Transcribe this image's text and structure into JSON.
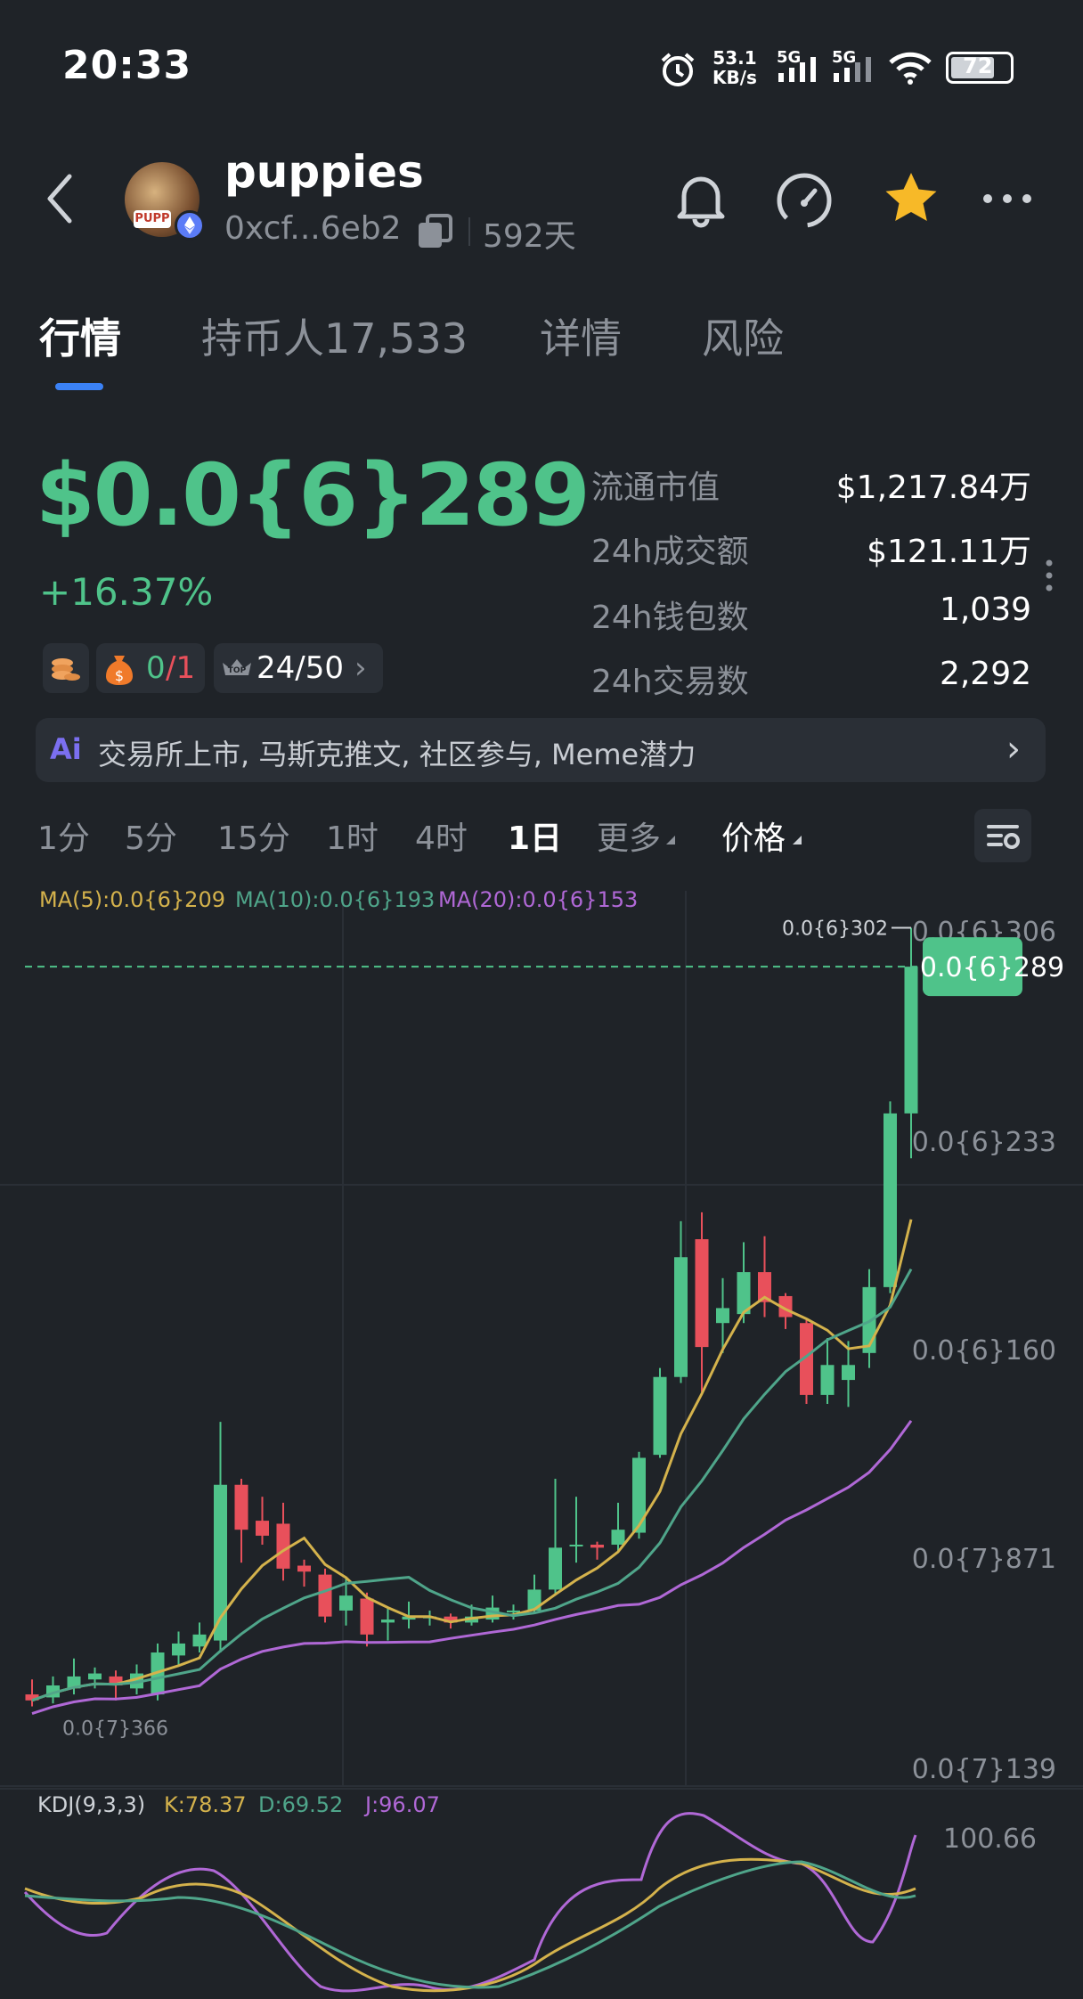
{
  "status_bar": {
    "time": "20:33",
    "net_speed_value": "53.1",
    "net_speed_unit": "KB/s",
    "sim1": "5G",
    "sim2": "5G",
    "battery": "72"
  },
  "token": {
    "name": "puppies",
    "address": "0xcf...6eb2",
    "age": "592天",
    "avatar_tag": "PUPP"
  },
  "tabs": [
    {
      "label": "行情"
    },
    {
      "label": "持币人17,533"
    },
    {
      "label": "详情"
    },
    {
      "label": "风险"
    }
  ],
  "price": {
    "value": "$0.0{6}289",
    "change": "+16.37%",
    "badge_fraction_ok": "0",
    "badge_fraction_total": "/1",
    "rank": "24/50"
  },
  "stats": [
    {
      "label": "流通市值",
      "value": "$1,217.84万"
    },
    {
      "label": "24h成交额",
      "value": "$121.11万"
    },
    {
      "label": "24h钱包数",
      "value": "1,039"
    },
    {
      "label": "24h交易数",
      "value": "2,292"
    }
  ],
  "ai_banner": {
    "icon": "Ai",
    "text": "交易所上市, 马斯克推文, 社区参与, Meme潜力"
  },
  "intervals": [
    {
      "label": "1分"
    },
    {
      "label": "5分"
    },
    {
      "label": "15分"
    },
    {
      "label": "1时"
    },
    {
      "label": "4时"
    },
    {
      "label": "1日",
      "active": true
    },
    {
      "label": "更多"
    },
    {
      "label": "价格"
    }
  ],
  "ma_legend": {
    "ma5": "MA(5):0.0{6}209",
    "ma10": "MA(10):0.0{6}193",
    "ma20": "MA(20):0.0{6}153"
  },
  "kdj_legend": {
    "name": "KDJ(9,3,3)",
    "k": "K:78.37",
    "d": "D:69.52",
    "j": "J:96.07"
  },
  "kdj_axis_top": "100.66",
  "colors": {
    "up": "#4fc38a",
    "down": "#e8505b",
    "ma5": "#d4b24c",
    "ma10": "#4fa58a",
    "ma20": "#b068d6",
    "kdj_k": "#d4b24c",
    "kdj_d": "#4fa58a",
    "kdj_j": "#b068d6"
  },
  "chart_data": {
    "type": "candlestick",
    "y_axis_labels": [
      "0.0{6}306",
      "0.0{6}233",
      "0.0{6}160",
      "0.0{7}871",
      "0.0{7}139"
    ],
    "y_axis_values": [
      3.06e-07,
      2.33e-07,
      1.6e-07,
      8.71e-08,
      1.39e-08
    ],
    "ylim": [
      1.39e-08,
      3.06e-07
    ],
    "current_price_label": "0.0{6}289",
    "current_price": 2.89e-07,
    "high_label": "0.0{6}302",
    "high": 3.02e-07,
    "low_label": "0.0{7}366",
    "low": 3.66e-08,
    "candles": [
      {
        "o": 46,
        "c": 44,
        "h": 51,
        "l": 42
      },
      {
        "o": 45,
        "c": 49,
        "h": 52,
        "l": 43
      },
      {
        "o": 48,
        "c": 52,
        "h": 58,
        "l": 46
      },
      {
        "o": 51,
        "c": 53,
        "h": 55,
        "l": 48
      },
      {
        "o": 52,
        "c": 49,
        "h": 54,
        "l": 44
      },
      {
        "o": 48,
        "c": 53,
        "h": 56,
        "l": 46
      },
      {
        "o": 46,
        "c": 60,
        "h": 63,
        "l": 44
      },
      {
        "o": 59,
        "c": 63,
        "h": 67,
        "l": 56
      },
      {
        "o": 62,
        "c": 66,
        "h": 70,
        "l": 60
      },
      {
        "o": 64,
        "c": 116,
        "h": 137,
        "l": 60
      },
      {
        "o": 116,
        "c": 101,
        "h": 118,
        "l": 90
      },
      {
        "o": 104,
        "c": 99,
        "h": 112,
        "l": 96
      },
      {
        "o": 103,
        "c": 88,
        "h": 110,
        "l": 84
      },
      {
        "o": 89,
        "c": 87,
        "h": 91,
        "l": 82
      },
      {
        "o": 86,
        "c": 72,
        "h": 88,
        "l": 70
      },
      {
        "o": 74,
        "c": 79,
        "h": 85,
        "l": 69
      },
      {
        "o": 78,
        "c": 66,
        "h": 80,
        "l": 62
      },
      {
        "o": 70,
        "c": 71,
        "h": 75,
        "l": 64
      },
      {
        "o": 71,
        "c": 72,
        "h": 77,
        "l": 68
      },
      {
        "o": 72,
        "c": 72,
        "h": 74,
        "l": 69
      },
      {
        "o": 72,
        "c": 70,
        "h": 73,
        "l": 68
      },
      {
        "o": 70,
        "c": 72,
        "h": 76,
        "l": 69
      },
      {
        "o": 71,
        "c": 75,
        "h": 79,
        "l": 70
      },
      {
        "o": 74,
        "c": 74,
        "h": 76,
        "l": 71
      },
      {
        "o": 74,
        "c": 81,
        "h": 86,
        "l": 73
      },
      {
        "o": 81,
        "c": 95,
        "h": 118,
        "l": 79
      },
      {
        "o": 96,
        "c": 96,
        "h": 112,
        "l": 90
      },
      {
        "o": 96,
        "c": 95,
        "h": 97,
        "l": 91
      },
      {
        "o": 96,
        "c": 101,
        "h": 110,
        "l": 94
      },
      {
        "o": 100,
        "c": 125,
        "h": 127,
        "l": 98
      },
      {
        "o": 126,
        "c": 152,
        "h": 155,
        "l": 125
      },
      {
        "o": 152,
        "c": 192,
        "h": 204,
        "l": 150
      },
      {
        "o": 198,
        "c": 162,
        "h": 207,
        "l": 147
      },
      {
        "o": 170,
        "c": 175,
        "h": 185,
        "l": 160
      },
      {
        "o": 173,
        "c": 187,
        "h": 197,
        "l": 170
      },
      {
        "o": 187,
        "c": 177,
        "h": 199,
        "l": 172
      },
      {
        "o": 179,
        "c": 172,
        "h": 180,
        "l": 168
      },
      {
        "o": 170,
        "c": 146,
        "h": 171,
        "l": 143
      },
      {
        "o": 146,
        "c": 156,
        "h": 165,
        "l": 143
      },
      {
        "o": 151,
        "c": 156,
        "h": 164,
        "l": 142
      },
      {
        "o": 160,
        "c": 182,
        "h": 188,
        "l": 155
      },
      {
        "o": 182,
        "c": 240,
        "h": 244,
        "l": 180
      },
      {
        "o": 240,
        "c": 289,
        "h": 302,
        "l": 225
      }
    ],
    "candle_value_unit": "×1e-9"
  }
}
